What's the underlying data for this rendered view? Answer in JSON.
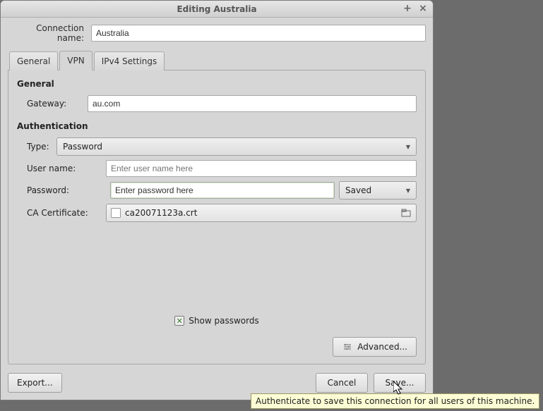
{
  "window": {
    "title": "Editing Australia"
  },
  "connection": {
    "label": "Connection name:",
    "value": "Australia"
  },
  "tabs": {
    "general": "General",
    "vpn": "VPN",
    "ipv4": "IPv4 Settings"
  },
  "vpn": {
    "general_section": "General",
    "gateway_label": "Gateway:",
    "gateway_value": "au.com",
    "auth_section": "Authentication",
    "type_label": "Type:",
    "type_value": "Password",
    "username_label": "User name:",
    "username_placeholder": "Enter user name here",
    "password_label": "Password:",
    "password_value": "Enter password here",
    "password_mode": "Saved",
    "ca_label": "CA Certificate:",
    "ca_file": "ca20071123a.crt",
    "show_passwords": "Show passwords",
    "advanced": "Advanced..."
  },
  "footer": {
    "export": "Export...",
    "cancel": "Cancel",
    "save": "Save..."
  },
  "tooltip": "Authenticate to save this connection for all users of this machine."
}
